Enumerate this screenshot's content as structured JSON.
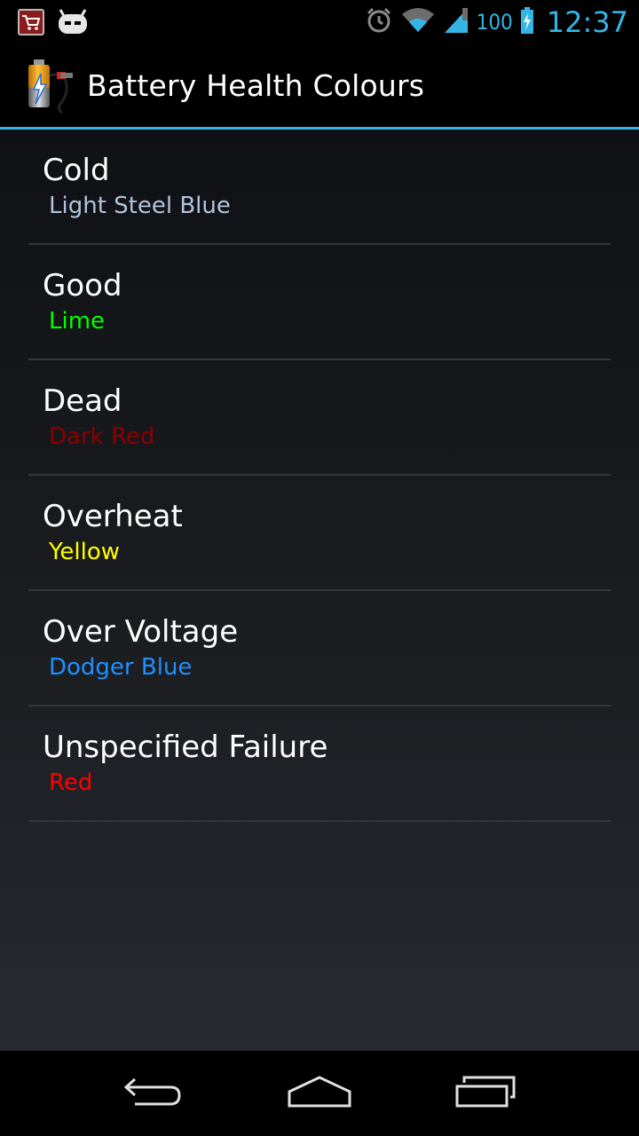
{
  "status_bar": {
    "battery_percent": "100",
    "time": "12:37",
    "icons": [
      "store-notification-icon",
      "cyanogenmod-notification-icon",
      "alarm-icon",
      "wifi-icon",
      "signal-icon",
      "battery-charging-icon"
    ]
  },
  "action_bar": {
    "title": "Battery Health Colours",
    "icon": "battery-app-icon"
  },
  "items": [
    {
      "title": "Cold",
      "subtitle": "Light Steel Blue",
      "color": "#b0c4de"
    },
    {
      "title": "Good",
      "subtitle": "Lime",
      "color": "#00ff00"
    },
    {
      "title": "Dead",
      "subtitle": "Dark Red",
      "color": "#8b0000"
    },
    {
      "title": "Overheat",
      "subtitle": "Yellow",
      "color": "#ffff00"
    },
    {
      "title": "Over Voltage",
      "subtitle": "Dodger Blue",
      "color": "#1e90ff"
    },
    {
      "title": "Unspecified Failure",
      "subtitle": "Red",
      "color": "#ff0000"
    }
  ],
  "nav_bar": {
    "icons": [
      "back-icon",
      "home-icon",
      "recents-icon"
    ]
  },
  "colors": {
    "accent": "#33b5e5",
    "divider": "#33363c"
  }
}
